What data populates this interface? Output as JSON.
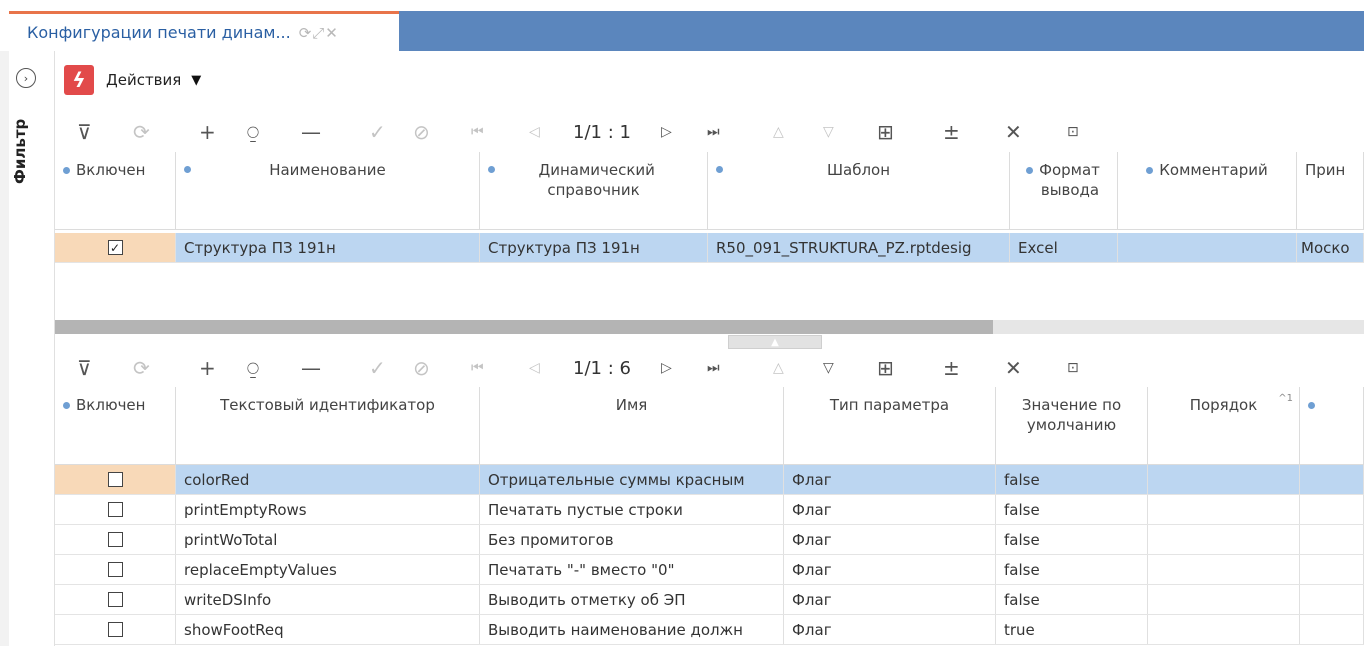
{
  "tab": {
    "title": "Конфигурации печати динам...",
    "icons": "⟳⤢✕"
  },
  "filter_panel": {
    "label": "Фильтр"
  },
  "actions": {
    "label": "Действия",
    "caret": "▼",
    "icon_glyph": "ϟ"
  },
  "toolbar_top": {
    "pager": "1/1 : 1"
  },
  "toolbar_bottom": {
    "pager": "1/1 : 6"
  },
  "toolbar_glyphs": {
    "filter": "⊽",
    "refresh": "⟳",
    "add": "+",
    "add_copy": "⍜",
    "remove": "—",
    "confirm": "✓",
    "cancel": "⊘",
    "first": "⏮",
    "prev": "◁",
    "next": "▷",
    "last": "⏭",
    "up": "△",
    "down": "▽",
    "grid": "⊞",
    "group": "±",
    "clear": "✕",
    "select": "⊡"
  },
  "top_grid": {
    "headers": [
      "Включен",
      "Наименование",
      "Динамический справочник",
      "Шаблон",
      "Формат вывода",
      "Комментарий",
      "Прин"
    ],
    "rows": [
      {
        "enabled": true,
        "check_glyph": "✓",
        "name": "Структура ПЗ 191н",
        "dictionary": "Структура ПЗ 191н",
        "template": "R50_091_STRUKTURA_PZ.rptdesig",
        "format": "Excel",
        "comment": "",
        "extra": "Моско"
      }
    ]
  },
  "bottom_grid": {
    "headers": [
      "Включен",
      "Текстовый идентификатор",
      "Имя",
      "Тип параметра",
      "Значение по умолчанию",
      "Порядок"
    ],
    "sort_indicator": "^1",
    "rows": [
      {
        "enabled": false,
        "id": "colorRed",
        "name": "Отрицательные суммы красным",
        "type": "Флаг",
        "default": "false"
      },
      {
        "enabled": false,
        "id": "printEmptyRows",
        "name": "Печатать пустые строки",
        "type": "Флаг",
        "default": "false"
      },
      {
        "enabled": false,
        "id": "printWoTotal",
        "name": "Без промитогов",
        "type": "Флаг",
        "default": "false"
      },
      {
        "enabled": false,
        "id": "replaceEmptyValues",
        "name": "Печатать \"-\" вместо \"0\"",
        "type": "Флаг",
        "default": "false"
      },
      {
        "enabled": false,
        "id": "writeDSInfo",
        "name": "Выводить отметку об ЭП",
        "type": "Флаг",
        "default": "false"
      },
      {
        "enabled": false,
        "id": "showFootReq",
        "name": "Выводить наименование должн",
        "type": "Флаг",
        "default": "true"
      }
    ]
  },
  "colors": {
    "accent": "#5b86bd",
    "tab_border": "#e8744a",
    "selected_row": "#bcd6f1",
    "selected_marker": "#f8d9b8",
    "action_icon": "#e24a4a"
  }
}
